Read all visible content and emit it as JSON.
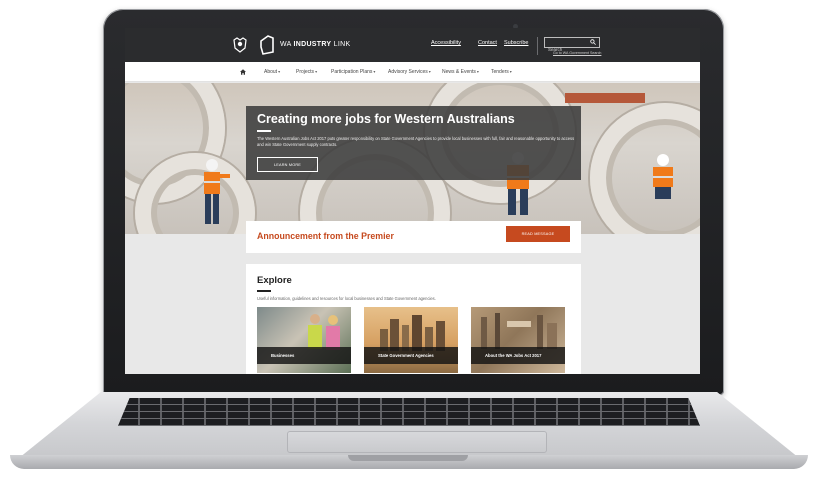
{
  "site": {
    "brand_prefix": "WA",
    "brand_bold": "INDUSTRY",
    "brand_suffix": "LINK"
  },
  "header": {
    "links": [
      "Accessibility",
      "Contact",
      "Subscribe"
    ],
    "search_placeholder": "Search",
    "search_sub": "Go to WA Government Search"
  },
  "nav": {
    "items": [
      "About",
      "Projects",
      "Participation Plans",
      "Advisory Services",
      "News & Events",
      "Tenders"
    ]
  },
  "hero": {
    "title": "Creating more jobs for Western Australians",
    "text": "The Western Australian Jobs Act 2017 puts greater responsibility on State Government Agencies to provide local businesses with full, fair and reasonable opportunity to access and win State Government supply contracts.",
    "button": "LEARN MORE"
  },
  "announcement": {
    "title": "Announcement from the Premier",
    "button": "READ MESSAGE"
  },
  "explore": {
    "title": "Explore",
    "description": "Useful information, guidelines and resources for local businesses and State Government agencies.",
    "cards": [
      {
        "label": "Businesses"
      },
      {
        "label": "State Government Agencies"
      },
      {
        "label": "About the WA Jobs Act 2017"
      }
    ]
  },
  "colors": {
    "accent": "#c64a1f",
    "topbar": "#2b2c2e",
    "overlay": "#3c3c3c"
  }
}
